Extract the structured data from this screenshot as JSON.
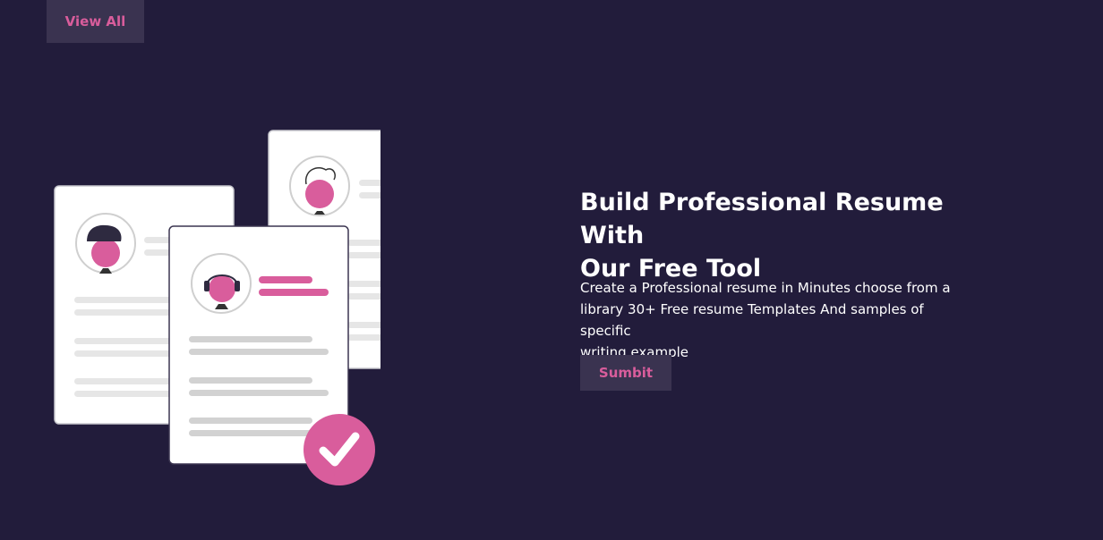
{
  "header": {
    "view_all_label": "View All"
  },
  "hero": {
    "title_line1": "Build Professional Resume With",
    "title_line2": "Our Free Tool",
    "desc_line1": "Create a Professional resume in Minutes choose from a",
    "desc_line2": "library 30+ Free resume Templates And samples of specific",
    "desc_line3": "writing example",
    "submit_label": "Sumbit"
  },
  "illustration": {
    "icon": "resume-documents-illustration",
    "check_icon": "checkmark-icon"
  },
  "colors": {
    "background": "#221c3b",
    "button_bg": "#3a3350",
    "accent": "#d95d9c",
    "text": "#ffffff"
  }
}
